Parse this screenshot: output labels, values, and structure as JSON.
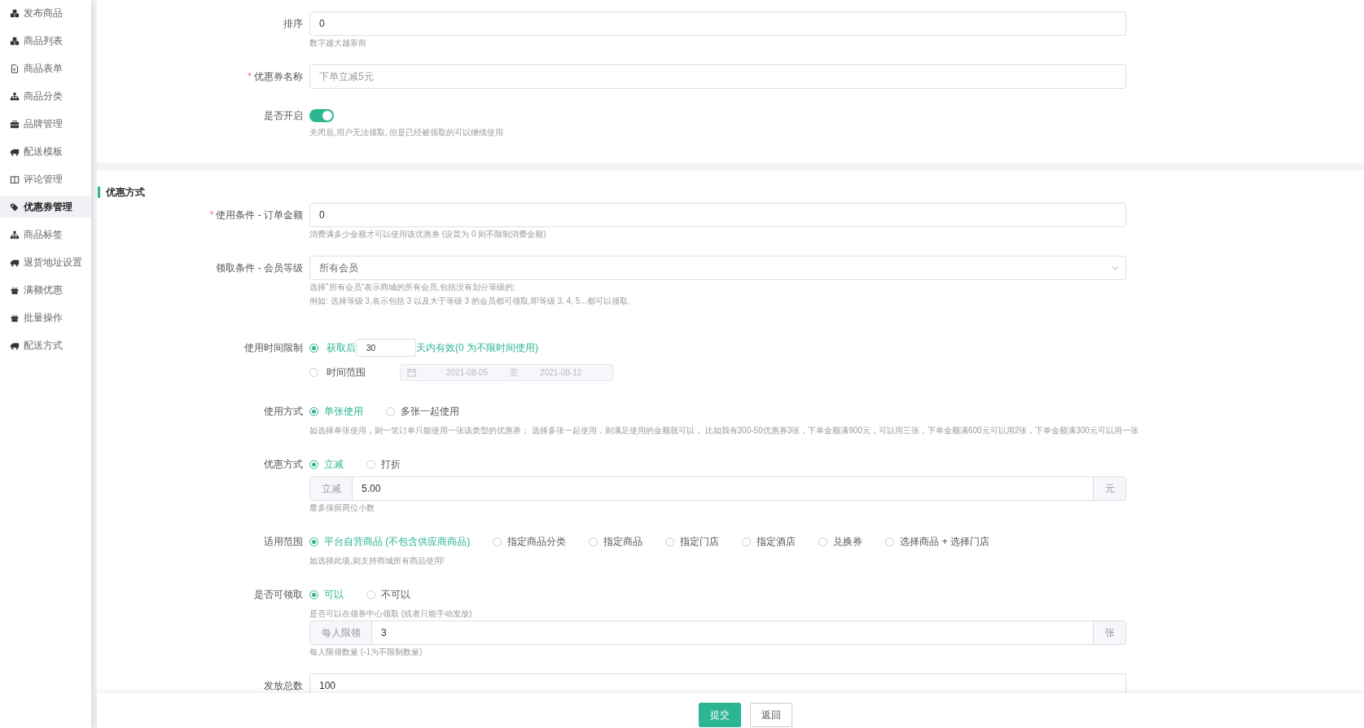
{
  "sidebar": {
    "items": [
      {
        "label": "发布商品",
        "selected": false
      },
      {
        "label": "商品列表",
        "selected": false
      },
      {
        "label": "商品表单",
        "selected": false
      },
      {
        "label": "商品分类",
        "selected": false
      },
      {
        "label": "品牌管理",
        "selected": false
      },
      {
        "label": "配送模板",
        "selected": false
      },
      {
        "label": "评论管理",
        "selected": false
      },
      {
        "label": "优惠券管理",
        "selected": true
      },
      {
        "label": "商品标签",
        "selected": false
      },
      {
        "label": "退货地址设置",
        "selected": false
      },
      {
        "label": "满额优惠",
        "selected": false
      },
      {
        "label": "批量操作",
        "selected": false
      },
      {
        "label": "配送方式",
        "selected": false
      }
    ]
  },
  "basic": {
    "fields": [
      {
        "label": "排序",
        "parts": [
          {
            "kind": "input",
            "value": "0"
          },
          {
            "kind": "help",
            "text": "数字越大越靠前"
          }
        ]
      },
      {
        "label": "优惠券名称",
        "required_mark": "*",
        "parts": [
          {
            "kind": "input",
            "placeholder": "下单立减5元"
          }
        ]
      },
      {
        "label": "是否开启",
        "parts": [
          {
            "kind": "switch",
            "on": true
          },
          {
            "kind": "help",
            "text": "关闭后,用户无法领取, 但是已经被领取的可以继续使用"
          }
        ]
      }
    ]
  },
  "discount": {
    "title": "优惠方式",
    "fields": [
      {
        "label": "使用条件 - 订单金额",
        "required_mark": "*",
        "parts": [
          {
            "kind": "input",
            "value": "0"
          },
          {
            "kind": "help",
            "text": "消费满多少金额才可以使用该优惠券 (设置为 0 则不限制消费金额)"
          }
        ]
      },
      {
        "label": "领取条件 - 会员等级",
        "parts": [
          {
            "kind": "select",
            "value": "所有会员"
          },
          {
            "kind": "help",
            "text": "选择\"所有会员\"表示商城的所有会员,包括没有划分等级的;"
          },
          {
            "kind": "help",
            "text": "例如: 选择等级 3,表示包括 3 以及大于等级 3 的会员都可领取,即等级 3, 4, 5...都可以领取."
          }
        ]
      },
      {
        "label": "使用时间限制",
        "parts": [
          {
            "kind": "time",
            "options": [
              {
                "selected": true,
                "prefix": "获取后",
                "value": "30",
                "suffix": "天内有效(0 为不限时间使用)"
              },
              {
                "selected": false,
                "label": "时间范围",
                "start": "2021-08-05",
                "separator": "至",
                "end": "2021-08-12"
              }
            ]
          }
        ]
      },
      {
        "label": "使用方式",
        "parts": [
          {
            "kind": "radio",
            "options": [
              {
                "label": "单张使用",
                "selected": true
              },
              {
                "label": "多张一起使用",
                "selected": false
              }
            ]
          },
          {
            "kind": "help",
            "text": "如选择单张使用，则一笔订单只能使用一张该类型的优惠券； 选择多张一起使用，则满足使用的金额就可以， 比如我有300-50优惠券3张，下单金额满900元，可以用三张，下单金额满600元可以用2张，下单金额满300元可以用一张"
          }
        ]
      },
      {
        "label": "优惠方式",
        "parts": [
          {
            "kind": "radio",
            "options": [
              {
                "label": "立减",
                "selected": true
              },
              {
                "label": "打折",
                "selected": false
              }
            ]
          },
          {
            "kind": "addon",
            "prepend": "立减",
            "value": "5.00",
            "append": "元"
          },
          {
            "kind": "help",
            "text": "最多保留两位小数"
          }
        ]
      },
      {
        "label": "适用范围",
        "parts": [
          {
            "kind": "radio",
            "options": [
              {
                "label": "平台自营商品 (不包含供应商商品)",
                "selected": true
              },
              {
                "label": "指定商品分类",
                "selected": false
              },
              {
                "label": "指定商品",
                "selected": false
              },
              {
                "label": "指定门店",
                "selected": false
              },
              {
                "label": "指定酒店",
                "selected": false
              },
              {
                "label": "兑换券",
                "selected": false
              },
              {
                "label": "选择商品 + 选择门店",
                "selected": false
              }
            ]
          },
          {
            "kind": "help",
            "text": "如选择此项,则支持商城所有商品使用!"
          }
        ]
      },
      {
        "label": "是否可领取",
        "parts": [
          {
            "kind": "radio",
            "options": [
              {
                "label": "可以",
                "selected": true
              },
              {
                "label": "不可以",
                "selected": false
              }
            ]
          },
          {
            "kind": "help",
            "text": "是否可以在领券中心领取 (或者只能手动发放)"
          },
          {
            "kind": "addon",
            "prepend": "每人限领",
            "value": "3",
            "append": "张"
          },
          {
            "kind": "help",
            "text": "每人限领数量 (-1为不限制数量)"
          }
        ]
      },
      {
        "label": "发放总数",
        "parts": [
          {
            "kind": "input",
            "value": "100"
          }
        ]
      }
    ]
  },
  "footer": {
    "buttons": [
      {
        "label": "提交",
        "kind": "primary"
      },
      {
        "label": "返回",
        "kind": "default"
      }
    ]
  }
}
